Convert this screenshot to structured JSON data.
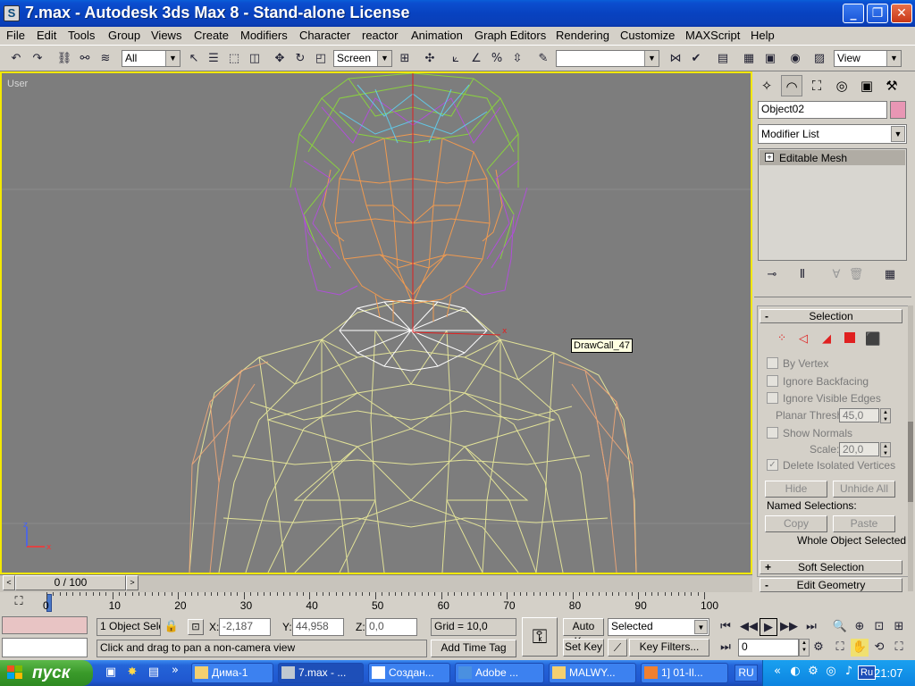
{
  "window": {
    "title": "7.max - Autodesk 3ds Max 8  - Stand-alone License",
    "app_icon": "S"
  },
  "menu": [
    "File",
    "Edit",
    "Tools",
    "Group",
    "Views",
    "Create",
    "Modifiers",
    "Character",
    "reactor",
    "Animation",
    "Graph Editors",
    "Rendering",
    "Customize",
    "MAXScript",
    "Help"
  ],
  "toolbar": {
    "selection_filter": "All",
    "ref_coord": "Screen",
    "named_selection": "",
    "viewport_view": "View"
  },
  "viewport": {
    "label": "User",
    "tooltip": "DrawCall_47",
    "axis": {
      "x": "x",
      "z": "z"
    }
  },
  "command_panel": {
    "object_name": "Object02",
    "object_color": "#e896b4",
    "modifier_list": "Modifier List",
    "stack_item": "Editable Mesh",
    "selection": {
      "header": "Selection",
      "by_vertex": "By Vertex",
      "ignore_backfacing": "Ignore Backfacing",
      "ignore_visible_edges": "Ignore Visible Edges",
      "planar_thresh_label": "Planar Thresh:",
      "planar_thresh_value": "45,0",
      "show_normals": "Show Normals",
      "scale_label": "Scale:",
      "scale_value": "20,0",
      "delete_isolated": "Delete Isolated Vertices",
      "hide": "Hide",
      "unhide_all": "Unhide All",
      "named_selections": "Named Selections:",
      "copy": "Copy",
      "paste": "Paste",
      "status": "Whole Object Selected"
    },
    "soft_selection": "Soft Selection",
    "edit_geometry": "Edit Geometry",
    "create": "Create",
    "delete": "Delete"
  },
  "timeline": {
    "frame": "0 / 100",
    "ticks": [
      "0",
      "10",
      "20",
      "30",
      "40",
      "50",
      "60",
      "70",
      "80",
      "90",
      "100"
    ]
  },
  "status": {
    "selected_count": "1 Object Sele",
    "x_label": "X:",
    "x_value": "-2,187",
    "y_label": "Y:",
    "y_value": "44,958",
    "z_label": "Z:",
    "z_value": "0,0",
    "grid": "Grid = 10,0",
    "prompt": "Click and drag to pan a non-camera view",
    "add_time_tag": "Add Time Tag",
    "auto_key": "Auto Key",
    "set_key": "Set Key",
    "key_mode": "Selected",
    "key_filters": "Key Filters...",
    "current_frame": "0"
  },
  "taskbar": {
    "start": "пуск",
    "tasks": [
      "Дима-1",
      "7.max - ...",
      "Создан...",
      "Adobe ...",
      "MALWY...",
      "1] 01-Il..."
    ],
    "lang_task": "RU",
    "tray_lang": "Ru",
    "clock": "21:07"
  }
}
